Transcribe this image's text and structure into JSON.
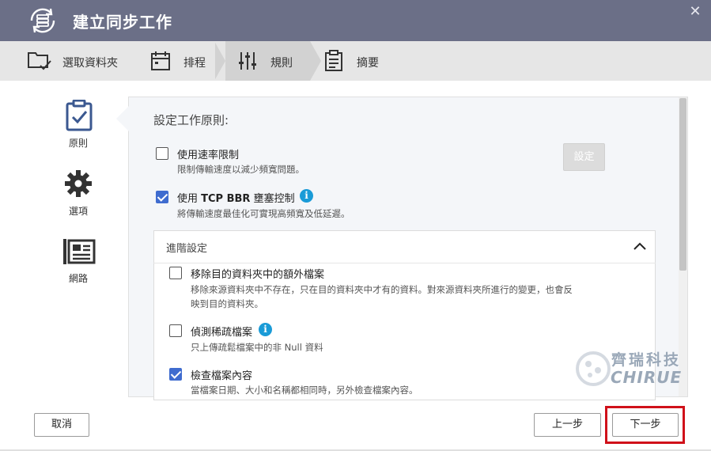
{
  "window": {
    "title": "建立同步工作",
    "close_glyph": "✕"
  },
  "steps": [
    {
      "label": "選取資料夾",
      "icon": "folder-check-icon"
    },
    {
      "label": "排程",
      "icon": "calendar-icon"
    },
    {
      "label": "規則",
      "icon": "sliders-icon",
      "active": true
    },
    {
      "label": "摘要",
      "icon": "clipboard-list-icon"
    }
  ],
  "sidebar": {
    "items": [
      {
        "label": "原則",
        "icon": "clipboard-check-icon",
        "active": true
      },
      {
        "label": "選項",
        "icon": "gear-icon"
      },
      {
        "label": "網路",
        "icon": "network-icon"
      }
    ]
  },
  "main": {
    "section_title": "設定工作原則:",
    "options": [
      {
        "label": "使用速率限制",
        "desc": "限制傳輸速度以減少頻寬問題。",
        "checked": false
      },
      {
        "label_prefix": "使用 ",
        "label_bold": "TCP BBR",
        "label_suffix": " 壅塞控制",
        "desc": "將傳輸速度最佳化可實現高頻寬及低延遲。",
        "checked": true,
        "info": "i"
      }
    ],
    "set_button": "設定",
    "advanced": {
      "title": "進階設定",
      "options": [
        {
          "label": "移除目的資料夾中的額外檔案",
          "desc_line1": "移除來源資料夾中不存在，只在目的資料夾中才有的資料。對來源資料夾所進行的變更，也會反",
          "desc_line2": "映到目的資料夾。",
          "checked": false
        },
        {
          "label": "偵測稀疏檔案",
          "desc": "只上傳疏鬆檔案中的非 Null 資料",
          "checked": false,
          "info": "i"
        },
        {
          "label": "檢查檔案內容",
          "desc": "當檔案日期、大小和名稱都相同時，另外檢查檔案內容。",
          "checked": true
        }
      ]
    }
  },
  "footer": {
    "cancel": "取消",
    "back": "上一步",
    "next": "下一步"
  },
  "watermark": {
    "cn": "齊瑞科技",
    "en": "CHIRUE"
  },
  "colors": {
    "titlebar": "#6b6f87",
    "accent": "#3f6ccf",
    "info": "#1a9bd7",
    "highlight": "#d0111a"
  }
}
